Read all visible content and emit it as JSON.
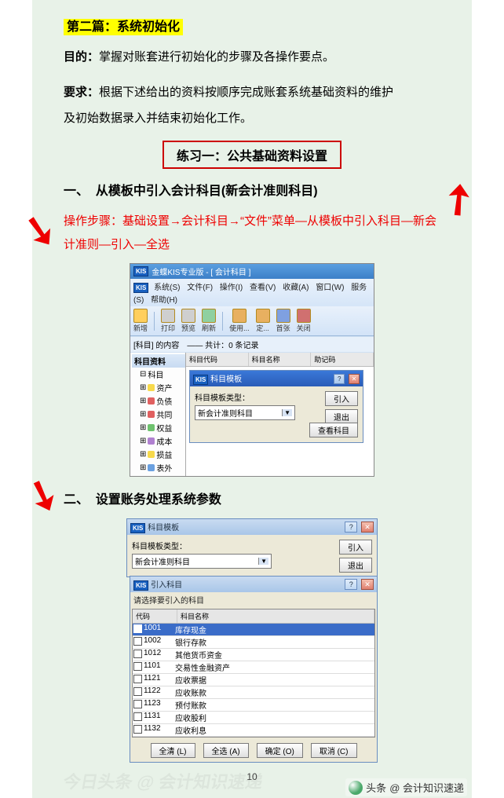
{
  "heading": "第二篇：系统初始化",
  "purpose_label": "目的：",
  "purpose_text": "掌握对账套进行初始化的步骤及各操作要点。",
  "req_label": "要求：",
  "req_text1": "根据下述给出的资料按顺序完成账套系统基础资料的维护",
  "req_text2": "及初始数据录入并结束初始化工作。",
  "exercise_box": "练习一：公共基础资料设置",
  "sec1_num": "一、",
  "sec1_title": "从模板中引入会计科目(新会计准则科目)",
  "sec1_steps": "操作步骤：基础设置→会计科目→“文件”菜单—从模板中引入科目—新会计准则—引入—全选",
  "sec2_num": "二、",
  "sec2_title": "设置账务处理系统参数",
  "page_number": "10",
  "author_prefix": "头条",
  "author_name": "@ 会计知识速递",
  "watermark": "今日头条 @ 会计知识速递",
  "shot1": {
    "app_title": "金蝶KIS专业版 - [ 会计科目 ]",
    "menu": [
      "系统(S)",
      "文件(F)",
      "操作(I)",
      "查看(V)",
      "收藏(A)",
      "窗口(W)",
      "服务(S)",
      "帮助(H)"
    ],
    "toolbar": [
      {
        "label": "新增"
      },
      {
        "label": "打印"
      },
      {
        "label": "预览"
      },
      {
        "label": "刷新"
      },
      {
        "label": "使用..."
      },
      {
        "label": "定..."
      },
      {
        "label": "首张"
      },
      {
        "label": "关闭"
      }
    ],
    "infobar_left": "[科目] 的内容",
    "infobar_right": "—— 共计：0 条记录",
    "tree_title": "科目资料",
    "tree_root": "科目",
    "tree_items": [
      "资产",
      "负债",
      "共同",
      "权益",
      "成本",
      "损益",
      "表外"
    ],
    "grid_headers": [
      "科目代码",
      "科目名称",
      "助记码"
    ],
    "dlg": {
      "title": "科目模板",
      "field_label": "科目模板类型：",
      "field_value": "新会计准则科目",
      "btn_import": "引入",
      "btn_exit": "退出",
      "btn_view": "查看科目"
    }
  },
  "shot2": {
    "dlg_a": {
      "title": "科目模板",
      "field_label": "科目模板类型：",
      "field_value": "新会计准则科目",
      "btn_import": "引入",
      "btn_exit": "退出"
    },
    "dlg_b": {
      "title": "引入科目",
      "hint": "请选择要引入的科目",
      "col_code": "代码",
      "col_name": "科目名称",
      "rows": [
        {
          "code": "1001",
          "name": "库存现金",
          "sel": true
        },
        {
          "code": "1002",
          "name": "银行存款"
        },
        {
          "code": "1012",
          "name": "其他货币资金"
        },
        {
          "code": "1101",
          "name": "交易性金融资产"
        },
        {
          "code": "1121",
          "name": "应收票据"
        },
        {
          "code": "1122",
          "name": "应收账款"
        },
        {
          "code": "1123",
          "name": "预付账款"
        },
        {
          "code": "1131",
          "name": "应收股利"
        },
        {
          "code": "1132",
          "name": "应收利息"
        }
      ],
      "btn_clear": "全清 (L)",
      "btn_all": "全选 (A)",
      "btn_ok": "确定 (O)",
      "btn_cancel": "取消 (C)"
    }
  }
}
